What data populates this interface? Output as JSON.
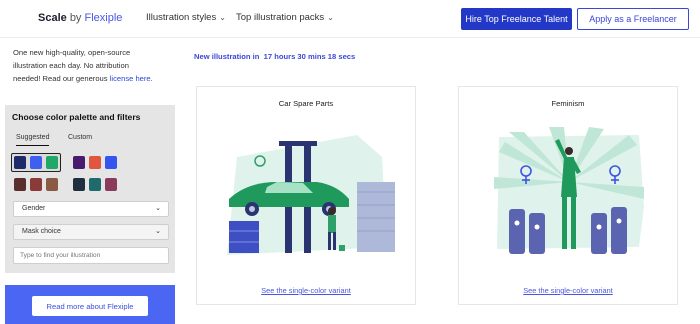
{
  "header": {
    "logo": {
      "scale": "Scale",
      "by": "by",
      "brand": "Flexiple"
    },
    "nav": [
      {
        "label": "Illustration styles"
      },
      {
        "label": "Top illustration packs"
      }
    ],
    "hire_button": "Hire Top Freelance Talent",
    "apply_button": "Apply as a Freelancer"
  },
  "sidebar": {
    "intro_line1": "One new high-quality, open-source",
    "intro_line2": "illustration each day. No attribution",
    "intro_line3": "needed! Read our generous",
    "intro_link": "license here",
    "intro_end": ".",
    "filters_title": "Choose color palette and filters",
    "tabs": [
      {
        "label": "Suggested"
      },
      {
        "label": "Custom"
      }
    ],
    "palettes": [
      [
        "#1f2a6b",
        "#3f5ff0",
        "#1fa86a"
      ],
      [
        "#4a1a6e",
        "#e2563f",
        "#3455f0"
      ],
      [
        "#5a2e2a",
        "#8b3a3a",
        "#8a5a45"
      ],
      [
        "#1f2f3f",
        "#1f6a6a",
        "#8a3a5a"
      ]
    ],
    "gender_select": "Gender",
    "mask_select": "Mask choice",
    "search_placeholder": "Type to find your illustration",
    "read_more_button": "Read more about Flexiple"
  },
  "main": {
    "countdown_prefix": "New illustration in",
    "countdown_time": "17 hours 30 mins 18 secs",
    "cards": [
      {
        "title": "Car Spare Parts",
        "variant_link": "See the single-color variant"
      },
      {
        "title": "Feminism",
        "variant_link": "See the single-color variant"
      }
    ]
  }
}
